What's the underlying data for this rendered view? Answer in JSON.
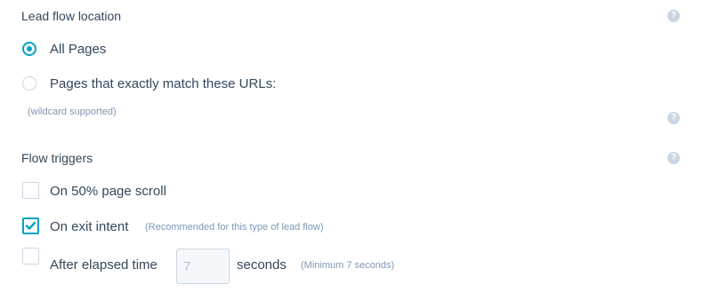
{
  "lead_flow_location": {
    "title": "Lead flow location",
    "help_icon": "question-icon",
    "options": [
      {
        "label": "All Pages",
        "selected": true
      },
      {
        "label": "Pages that exactly match these URLs:",
        "selected": false
      }
    ],
    "hint": "(wildcard supported)"
  },
  "flow_triggers": {
    "title": "Flow triggers",
    "help_icon": "question-icon",
    "scroll": {
      "label": "On 50% page scroll",
      "checked": false
    },
    "exit_intent": {
      "label": "On exit intent",
      "hint": "(Recommended for this type of lead flow)",
      "checked": true
    },
    "elapsed": {
      "label": "After elapsed time",
      "value": "7",
      "unit": "seconds",
      "hint": "(Minimum 7 seconds)",
      "checked": false
    }
  },
  "colors": {
    "accent": "#00a4bd",
    "text": "#33475b",
    "muted": "#7c98b6",
    "border": "#cbd6e2"
  }
}
